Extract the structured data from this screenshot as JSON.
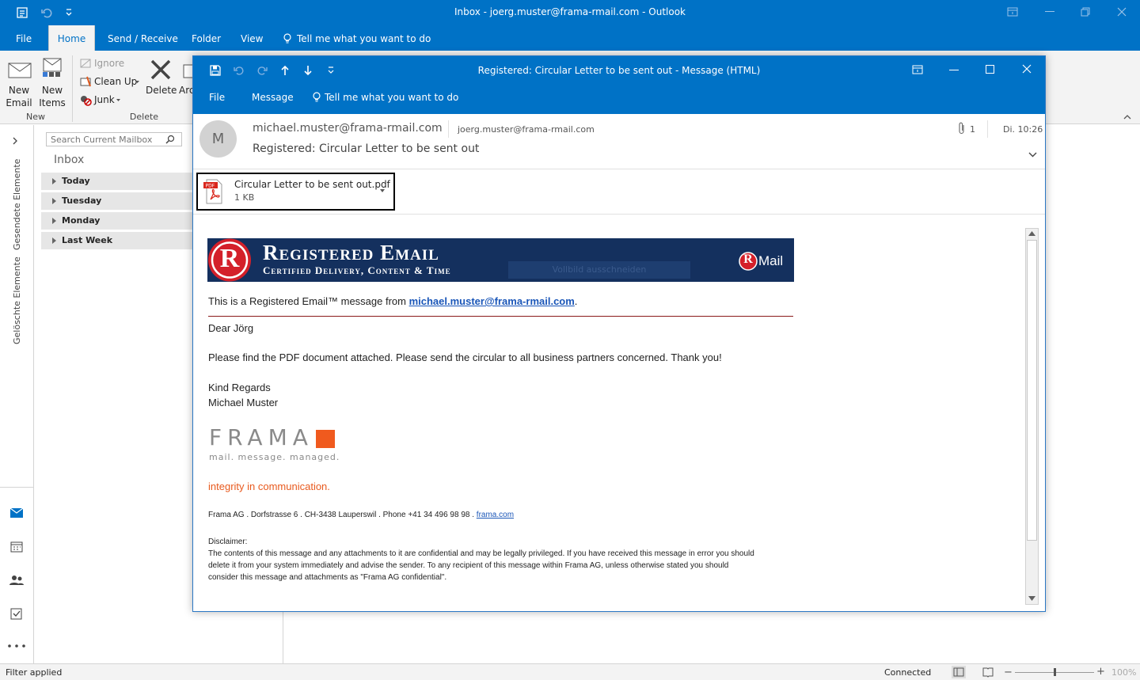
{
  "window": {
    "title": "Inbox - joerg.muster@frama-rmail.com  -  Outlook"
  },
  "ribbon_tabs": [
    "File",
    "Home",
    "Send / Receive",
    "Folder",
    "View"
  ],
  "tell_me": "Tell me what you want to do",
  "ribbon": {
    "new_email": [
      "New",
      "Email"
    ],
    "new_items": [
      "New",
      "Items"
    ],
    "ignore": "Ignore",
    "clean_up": "Clean Up",
    "junk": "Junk",
    "delete": "Delete",
    "archive_partial": "Arc",
    "group_new": "New",
    "group_delete": "Delete"
  },
  "left_nav": {
    "sent": "Gesendete Elemente",
    "deleted": "Gelöschte Elemente"
  },
  "folder_pane": {
    "search_placeholder": "Search Current Mailbox",
    "inbox_label": "Inbox",
    "groups": [
      "Today",
      "Tuesday",
      "Monday",
      "Last Week"
    ]
  },
  "status": {
    "left": "Filter applied",
    "connected": "Connected",
    "zoom": "100%"
  },
  "message": {
    "title": "Registered: Circular Letter to be sent out  -  Message (HTML)",
    "tabs": [
      "File",
      "Message"
    ],
    "tell_me": "Tell me what you want to do",
    "avatar_letter": "M",
    "from": "michael.muster@frama-rmail.com",
    "to": "joerg.muster@frama-rmail.com",
    "subject": "Registered: Circular Letter to be sent out",
    "attachment_count": "1",
    "time": "Di. 10:26",
    "attachment": {
      "name": "Circular Letter to be sent out.pdf",
      "size": "1 KB",
      "icon_label": "PDF"
    },
    "body": {
      "banner_letter": "R",
      "banner_title": "Registered Email",
      "banner_subtitle": "Certified Delivery, Content & Time",
      "banner_badge_r": "R",
      "banner_badge_mail": "Mail",
      "banner_overlay": "Vollbild ausschneiden",
      "intro_prefix": "This is a Registered Email™ message from ",
      "intro_link": "michael.muster@frama-rmail.com",
      "intro_suffix": ".",
      "greeting": "Dear Jörg",
      "text": "Please find the PDF document attached. Please send the circular to all business partners concerned. Thank you!",
      "regards1": "Kind Regards",
      "regards2": "Michael Muster",
      "logo_name": "FRAMA",
      "logo_tagline": "mail. message. managed.",
      "integrity": "integrity in communication.",
      "address_prefix": "Frama AG . Dorfstrasse 6 . CH-3438 Lauperswil . Phone +41 34 496 98 98 . ",
      "address_link": "frama.com",
      "disclaimer_title": "Disclaimer:",
      "disclaimer_l1": "The contents of this message and any attachments to it are confidential and may be legally privileged. If you have received this message in error you should",
      "disclaimer_l2": "delete it from your system immediately and advise the sender. To any recipient of this message within Frama AG, unless otherwise stated you should",
      "disclaimer_l3": "consider this message and attachments as \"Frama AG confidential\"."
    }
  },
  "colors": {
    "outlook_blue": "#0072c6",
    "banner_navy": "#14305e",
    "frama_orange": "#f05a1e",
    "link_blue": "#1a56b8"
  }
}
